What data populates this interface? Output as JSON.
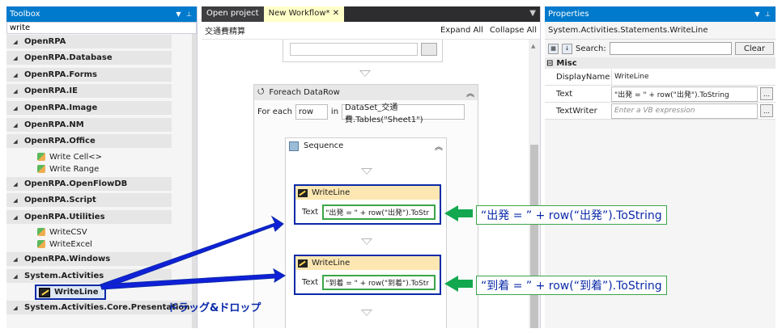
{
  "toolbox": {
    "title": "Toolbox",
    "search_value": "write",
    "categories": [
      "OpenRPA",
      "OpenRPA.Database",
      "OpenRPA.Forms",
      "OpenRPA.IE",
      "OpenRPA.Image",
      "OpenRPA.NM",
      "OpenRPA.Office",
      "OpenRPA.OpenFlowDB",
      "OpenRPA.Script",
      "OpenRPA.Utilities",
      "OpenRPA.Windows",
      "System.Activities",
      "System.Activities.Core.Presentation"
    ],
    "office_items": [
      "Write Cell<>",
      "Write Range"
    ],
    "utilities_items": [
      "WriteCSV",
      "WriteExcel"
    ],
    "system_items": [
      "WriteLine"
    ]
  },
  "designer": {
    "tabs": [
      "Open project",
      "New Workflow*"
    ],
    "breadcrumb": "交通費精算",
    "expand_all": "Expand All",
    "collapse_all": "Collapse All",
    "foreach": {
      "title": "Foreach DataRow",
      "for_each_label": "For each",
      "var": "row",
      "in_label": "in",
      "source": "DataSet_交通費.Tables(\"Sheet1\")"
    },
    "sequence_title": "Sequence",
    "writeline1": {
      "title": "WriteLine",
      "text_label": "Text",
      "text_value": "\"出発 = \" + row(\"出発\").ToStr"
    },
    "writeline2": {
      "title": "WriteLine",
      "text_label": "Text",
      "text_value": "\"到着 = \" + row(\"到着\").ToStr"
    }
  },
  "properties": {
    "title": "Properties",
    "type_name": "System.Activities.Statements.WriteLine",
    "search_label": "Search:",
    "clear_label": "Clear",
    "section": "Misc",
    "rows": [
      {
        "key": "DisplayName",
        "value": "WriteLine"
      },
      {
        "key": "Text",
        "value": "\"出発 = \" + row(\"出発\").ToString"
      },
      {
        "key": "TextWriter",
        "value": "Enter a VB expression"
      }
    ]
  },
  "annotations": {
    "callout1": "“出発 = ” + row(“出発”).ToString",
    "callout2": "“到着 = ” + row(“到着”).ToString",
    "drag_drop": "ドラッグ&ドロップ"
  },
  "colors": {
    "title_blue": "#007acc",
    "annotation_blue": "#0a2aa8",
    "annotation_green": "#3aa64a",
    "arrow_green": "#13a84f"
  }
}
